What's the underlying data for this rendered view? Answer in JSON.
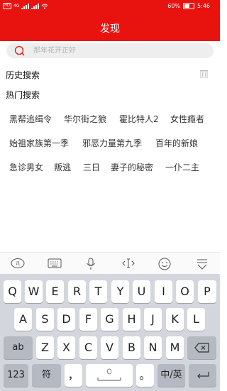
{
  "status_bar": {
    "sim_label": "HD",
    "network": "4G",
    "battery": "60%",
    "time": "5:46"
  },
  "header": {
    "title": "发现"
  },
  "search": {
    "placeholder": "那年花开正好"
  },
  "history": {
    "title": "历史搜索"
  },
  "hot": {
    "title": "热门搜索",
    "rows": [
      [
        "黑帮追缉令",
        "华尔街之狼",
        "霍比特人2",
        "女性瘾者"
      ],
      [
        "始祖家族第一季",
        "邪恶力量第九季",
        "百年的新娘"
      ],
      [
        "急诊男女",
        "叛逃",
        "三日",
        "妻子的秘密",
        "一仆二主"
      ]
    ]
  },
  "keyboard": {
    "toolbar": [
      "emoji-sticker-icon",
      "keyboard-icon",
      "microphone-icon",
      "cursor-icon",
      "smiley-icon",
      "collapse-keyboard-icon"
    ],
    "row1": [
      "Q",
      "W",
      "E",
      "R",
      "T",
      "Y",
      "U",
      "I",
      "O",
      "P"
    ],
    "row2": [
      "A",
      "S",
      "D",
      "F",
      "G",
      "H",
      "J",
      "K",
      "L"
    ],
    "row3": [
      "Z",
      "X",
      "C",
      "V",
      "B",
      "N",
      "M"
    ],
    "shift_label": "ab",
    "numbers_label": "123",
    "symbols_label": "符",
    "comma_label": "，",
    "period_label": "。",
    "lang_label": "中/英"
  }
}
